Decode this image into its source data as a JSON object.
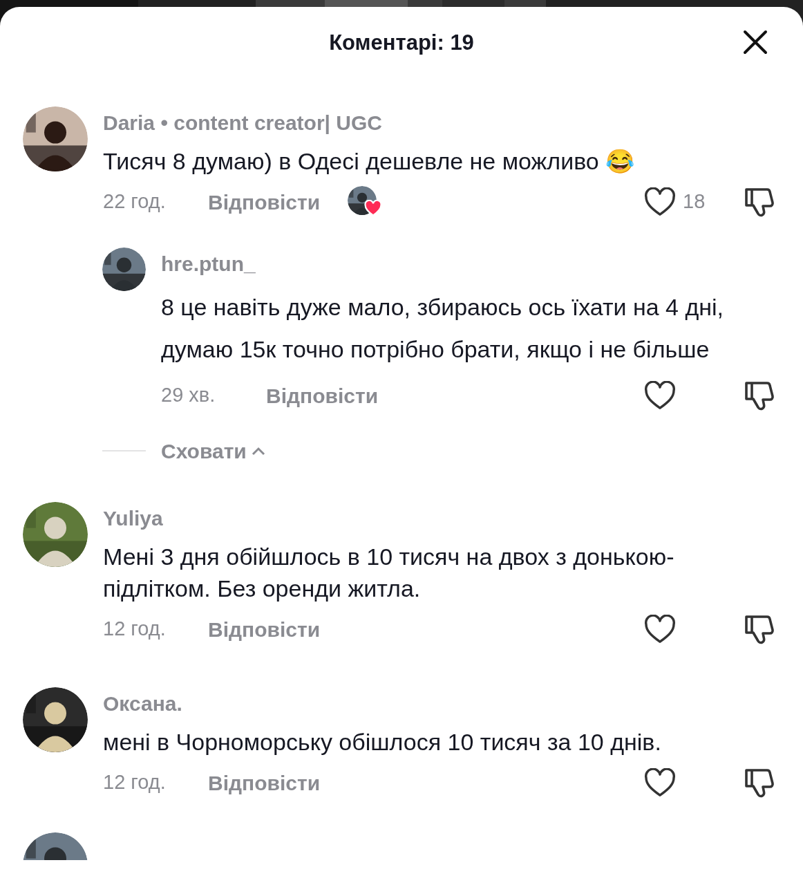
{
  "sheet": {
    "title": "Коментарі: 19"
  },
  "comments": [
    {
      "author": "Daria • content creator| UGC",
      "text": "Тисяч 8 думаю) в Одесі дешевле не можливо 😂",
      "time": "22 год.",
      "reply_label": "Відповісти",
      "liked_by_creator": true,
      "likes": "18",
      "replies": [
        {
          "author": "hre.ptun_",
          "text": "8 це навіть дуже мало, збираюсь ось їхати на 4 дні, думаю 15к точно потрібно брати, якщо і не більше",
          "time": "29 хв.",
          "reply_label": "Відповісти",
          "liked_by_creator": false
        }
      ],
      "collapse_label": "Сховати"
    },
    {
      "author": "Yuliya",
      "text": "Мені 3 дня обійшлось в 10 тисяч на двох з донькою- підлітком. Без оренди житла.",
      "time": "12 год.",
      "reply_label": "Відповісти",
      "liked_by_creator": false
    },
    {
      "author": "Оксана.",
      "text": "мені в Чорноморську обішлося 10 тисяч за 10 днів.",
      "time": "12 год.",
      "reply_label": "Відповісти",
      "liked_by_creator": false
    }
  ]
}
